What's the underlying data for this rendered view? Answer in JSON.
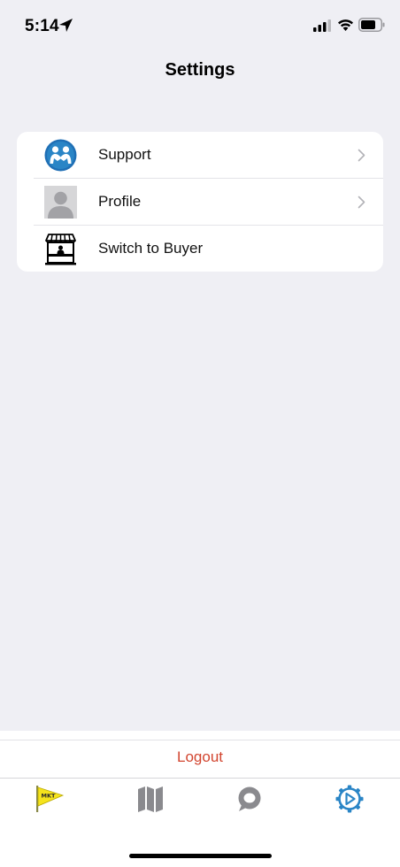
{
  "status_bar": {
    "time": "5:14",
    "icons": [
      "location-arrow-icon",
      "signal-icon",
      "wifi-icon",
      "battery-icon"
    ]
  },
  "nav": {
    "title": "Settings"
  },
  "settings": {
    "items": [
      {
        "label": "Support",
        "icon": "support-icon",
        "has_chevron": true
      },
      {
        "label": "Profile",
        "icon": "profile-avatar-icon",
        "has_chevron": true
      },
      {
        "label": "Switch to Buyer",
        "icon": "storefront-icon",
        "has_chevron": false
      }
    ]
  },
  "logout": {
    "label": "Logout",
    "color": "#d2452f"
  },
  "tab_bar": {
    "tabs": [
      {
        "icon": "mkt-flag-icon",
        "active": false
      },
      {
        "icon": "map-icon",
        "active": false
      },
      {
        "icon": "chat-bubble-icon",
        "active": false
      },
      {
        "icon": "settings-gear-icon",
        "active": true
      }
    ],
    "active_color": "#2a85c6",
    "inactive_color": "#8a8a8e"
  },
  "colors": {
    "background": "#efeff4",
    "card": "#ffffff",
    "accent": "#2a85c6"
  }
}
